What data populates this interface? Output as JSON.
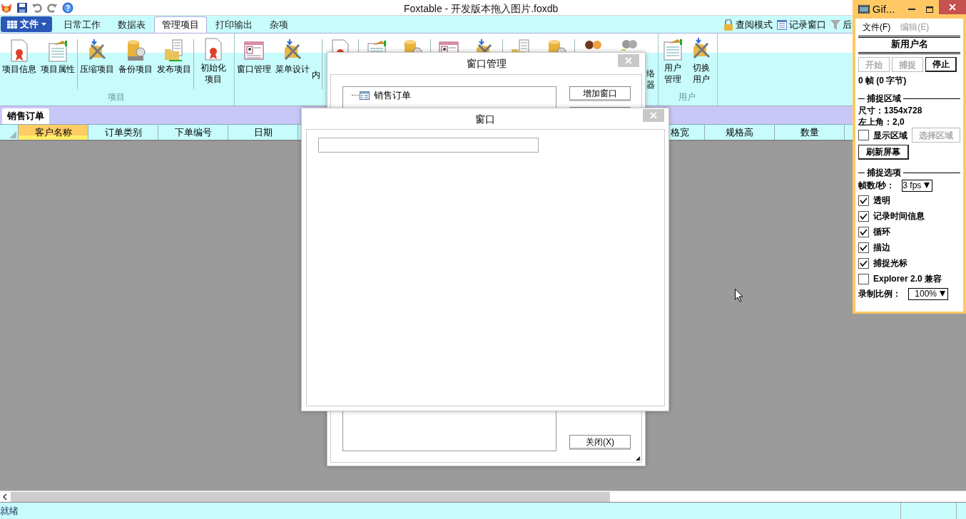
{
  "title_bar": {
    "title": "Foxtable - 开发版本拖入图片.foxdb"
  },
  "ribbon": {
    "file_menu": "文件",
    "tabs": [
      {
        "label": "日常工作",
        "selected": false
      },
      {
        "label": "数据表",
        "selected": false
      },
      {
        "label": "管理项目",
        "selected": true
      },
      {
        "label": "打印输出",
        "selected": false
      },
      {
        "label": "杂项",
        "selected": false
      }
    ],
    "right_items": [
      {
        "label": "查阅模式"
      },
      {
        "label": "记录窗口"
      },
      {
        "label": "后"
      }
    ],
    "groups": [
      {
        "label": "项目",
        "sections": [
          [
            {
              "lines": [
                "项目信息"
              ]
            },
            {
              "lines": [
                "项目属性"
              ]
            }
          ],
          [
            {
              "lines": [
                "压缩项目"
              ]
            },
            {
              "lines": [
                "备份项目"
              ]
            },
            {
              "lines": [
                "发布项目"
              ]
            }
          ],
          [
            {
              "lines": [
                "初始化",
                "项目"
              ]
            }
          ]
        ]
      },
      {
        "sections": [
          [
            {
              "lines": [
                "窗口管理"
              ]
            },
            {
              "lines": [
                "菜单设计"
              ]
            },
            {
              "kind": "partial",
              "lines": [
                "内"
              ]
            }
          ],
          [
            {
              "kind": "icon"
            }
          ],
          [
            {
              "kind": "icon"
            },
            {
              "kind": "icon"
            }
          ],
          [
            {
              "kind": "icon"
            },
            {
              "kind": "icon"
            }
          ],
          [
            {
              "kind": "icon"
            },
            {
              "kind": "icon"
            }
          ],
          [
            {
              "kind": "icon"
            },
            {
              "kind": "icon"
            },
            {
              "kind": "partial",
              "lines": [
                "络",
                "器"
              ]
            }
          ]
        ]
      },
      {
        "label": "用户",
        "sections": [
          [
            {
              "lines": [
                "用户",
                "管理"
              ]
            },
            {
              "lines": [
                "切换",
                "用户"
              ]
            }
          ]
        ]
      }
    ]
  },
  "document_tab": {
    "label": "销售订单"
  },
  "table": {
    "columns_left": [
      {
        "label": "客户名称",
        "selected": true
      },
      {
        "label": "订单类别",
        "selected": false
      },
      {
        "label": "下单编号",
        "selected": false
      },
      {
        "label": "日期",
        "selected": false
      }
    ],
    "columns_right": [
      {
        "label": "格宽",
        "selected": false
      },
      {
        "label": "规格高",
        "selected": false
      },
      {
        "label": "数量",
        "selected": false
      }
    ]
  },
  "status_bar": {
    "text": "就绪"
  },
  "window_manager_dialog": {
    "title": "窗口管理",
    "tree": [
      {
        "label": "销售订单"
      }
    ],
    "buttons": [
      "增加窗口",
      "关闭(X)"
    ]
  },
  "window_dialog": {
    "title": "窗口"
  },
  "gif_window": {
    "title": "Gif...",
    "menu": [
      {
        "label": "文件(F)",
        "disabled": false
      },
      {
        "label": "编辑(E)",
        "disabled": true
      }
    ],
    "user_name": "新用户名",
    "buttons": [
      {
        "label": "开始",
        "disabled": true
      },
      {
        "label": "捕捉",
        "disabled": true
      },
      {
        "label": "停止",
        "disabled": false
      }
    ],
    "frames": "0 帧 (0 字节)",
    "capture_area": {
      "heading": "捕捉区域",
      "size": "尺寸：1354x728",
      "origin": "左上角：2,0",
      "show_area": {
        "label": "显示区域",
        "checked": false
      },
      "select_button": {
        "label": "选择区域",
        "disabled": true
      },
      "refresh_button": "刷新屏幕"
    },
    "options": {
      "heading": "捕捉选项",
      "fps_label": "帧数/秒：",
      "fps_value": "3 fps",
      "checkboxes": [
        {
          "label": "透明",
          "checked": true
        },
        {
          "label": "记录时间信息",
          "checked": true
        },
        {
          "label": "循环",
          "checked": true
        },
        {
          "label": "描边",
          "checked": true
        },
        {
          "label": "捕捉光标",
          "checked": true
        },
        {
          "label": "Explorer 2.0 兼容",
          "checked": false
        }
      ],
      "scale_label": "录制比例：",
      "scale_value": "100%"
    }
  }
}
